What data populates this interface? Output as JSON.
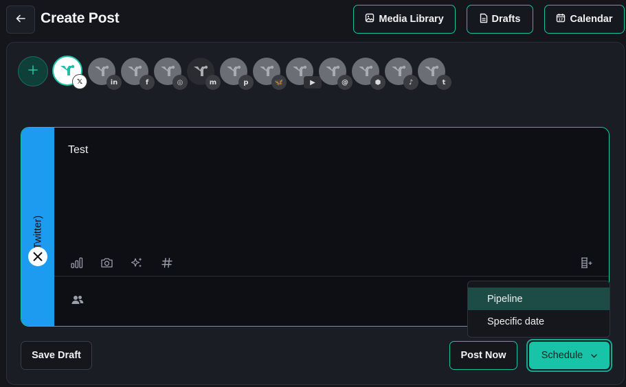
{
  "header": {
    "title": "Create Post",
    "back_icon": "arrow-left-icon",
    "buttons": [
      {
        "label": "Media Library",
        "icon": "image-icon"
      },
      {
        "label": "Drafts",
        "icon": "document-icon"
      },
      {
        "label": "Calendar",
        "icon": "calendar-icon"
      }
    ]
  },
  "accounts": {
    "add_icon": "plus-icon",
    "items": [
      {
        "platform": "X",
        "badge": "𝕏",
        "selected": true
      },
      {
        "platform": "LinkedIn",
        "badge": "in",
        "selected": false
      },
      {
        "platform": "Facebook",
        "badge": "f",
        "selected": false
      },
      {
        "platform": "Instagram",
        "badge": "◎",
        "selected": false
      },
      {
        "platform": "Mastodon",
        "badge": "m",
        "selected": false
      },
      {
        "platform": "Pinterest",
        "badge": "p",
        "selected": false
      },
      {
        "platform": "Bluesky",
        "badge": "🦋",
        "selected": false
      },
      {
        "platform": "YouTube",
        "badge": "▶",
        "selected": false
      },
      {
        "platform": "Threads",
        "badge": "@",
        "selected": false
      },
      {
        "platform": "Google Business",
        "badge": "⬢",
        "selected": false
      },
      {
        "platform": "TikTok",
        "badge": "♪",
        "selected": false
      },
      {
        "platform": "Tumblr",
        "badge": "t",
        "selected": false
      }
    ]
  },
  "editor": {
    "platform_label": "X (Twitter)",
    "text": "Test",
    "tools": [
      "poll-icon",
      "camera-icon",
      "ai-sparkles-icon",
      "hashtag-icon"
    ],
    "right_tool": "thread-add-icon",
    "footer_icon": "mentions-icon"
  },
  "schedule_menu": {
    "items": [
      "Pipeline",
      "Specific date"
    ],
    "highlighted": "Pipeline"
  },
  "footer": {
    "save_draft": "Save Draft",
    "post_now": "Post Now",
    "schedule": "Schedule"
  },
  "colors": {
    "accent": "#19c3a8",
    "background": "#14161c",
    "panel": "#1b1d24",
    "editor": "#0d0f14",
    "x_sidebar": "#1d9bf0"
  }
}
